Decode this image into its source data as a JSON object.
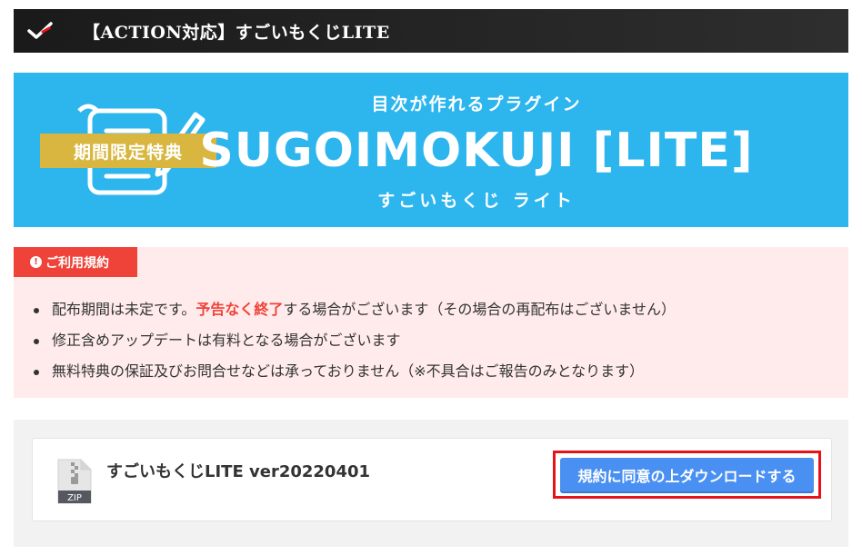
{
  "header": {
    "title": "【ACTION対応】すごいもくじLITE",
    "check_icon": "checkmark-icon"
  },
  "banner": {
    "subtitle": "目次が作れるプラグイン",
    "main_title": "SUGOIMOKUJI [LITE]",
    "kana": "すごいもくじ ライト",
    "ribbon": "期間限定特典",
    "doc_icon": "document-pencil-icon",
    "color": "#2db5ee",
    "ribbon_color": "#d8b63f"
  },
  "terms": {
    "label": "ご利用規約",
    "items": [
      {
        "pre": "配布期間は未定です。",
        "em": "予告なく終了",
        "post": "する場合がございます（その場合の再配布はございません）"
      },
      {
        "pre": "修正含めアップデートは有料となる場合がございます",
        "em": "",
        "post": ""
      },
      {
        "pre": "無料特典の保証及びお問合せなどは承っておりません（※不具合はご報告のみとなります）",
        "em": "",
        "post": ""
      }
    ],
    "accent_color": "#ef4238",
    "bg_color": "#ffebeb"
  },
  "download": {
    "file_icon_label": "ZIP",
    "file_name": "すごいもくじLITE ver20220401",
    "button_label": "規約に同意の上ダウンロードする",
    "button_color": "#4a90f2",
    "highlight_color": "#e5141a"
  }
}
